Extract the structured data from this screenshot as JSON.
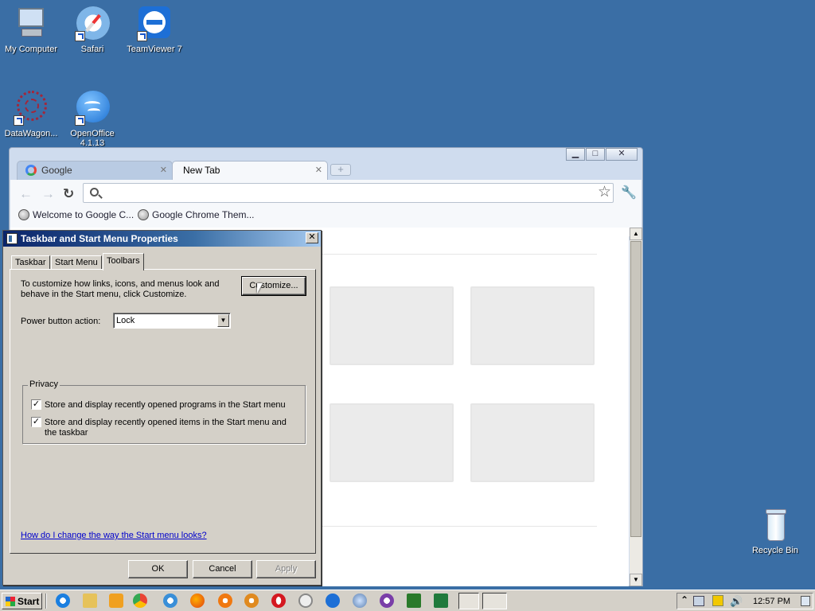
{
  "desktop": {
    "icons": [
      {
        "label": "My Computer"
      },
      {
        "label": "Safari"
      },
      {
        "label": "TeamViewer 7"
      },
      {
        "label": "DataWagon..."
      },
      {
        "label": "OpenOffice 4.1.13"
      },
      {
        "label": "Recycle Bin"
      }
    ]
  },
  "browser": {
    "tabs": [
      {
        "label": "Google",
        "close": "✕"
      },
      {
        "label": "New Tab",
        "close": "✕"
      }
    ],
    "new_tab_symbol": "+",
    "window_controls": {
      "minimize": "▁",
      "maximize": "□",
      "close": "✕"
    },
    "nav": {
      "back": "←",
      "forward": "→",
      "reload": "↻"
    },
    "omnibox": {
      "value": "",
      "placeholder": ""
    },
    "bookmarks": [
      {
        "label": "Welcome to Google C..."
      },
      {
        "label": "Google Chrome Them..."
      }
    ]
  },
  "dialog": {
    "title": "Taskbar and Start Menu Properties",
    "close_symbol": "✕",
    "tabs": [
      "Taskbar",
      "Start Menu",
      "Toolbars"
    ],
    "active_tab": "Toolbars",
    "customize_text": "To customize how links, icons, and menus look and behave in the Start menu, click Customize.",
    "customize_button": "Customize...",
    "power_label": "Power button action:",
    "power_value": "Lock",
    "privacy_legend": "Privacy",
    "checkbox1": {
      "label": "Store and display recently opened programs in the Start menu",
      "checked": true
    },
    "checkbox2": {
      "label": "Store and display recently opened items in the Start menu and the taskbar",
      "checked": true
    },
    "help_link": "How do I change the way the Start menu looks?",
    "ok": "OK",
    "cancel": "Cancel",
    "apply": "Apply"
  },
  "taskbar": {
    "start_label": "Start",
    "clock": "12:57 PM",
    "tray_expand": "⌃"
  },
  "colors": {
    "desktop": "#3a6ea5",
    "title_active_start": "#0a246a",
    "link": "#0000cc"
  }
}
